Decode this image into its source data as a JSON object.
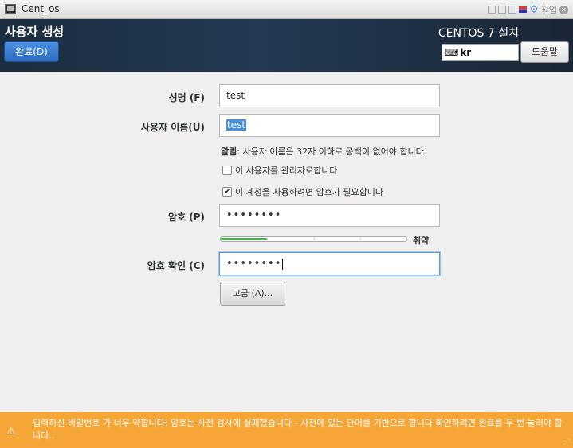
{
  "window": {
    "title": "Cent_os",
    "workspace_label": "작업"
  },
  "header": {
    "page_title": "사용자 생성",
    "done_label": "완료(D)",
    "product_title": "CENTOS 7 설치",
    "keyboard_layout": "kr",
    "help_label": "도움말"
  },
  "form": {
    "fullname": {
      "label": "성명 (F)",
      "value": "test"
    },
    "username": {
      "label": "사용자 이름(U)",
      "value": "test"
    },
    "hint": {
      "prefix": "알림",
      "text": ": 사용자 이름은 32자 이하로 공백이 없어야 합니다."
    },
    "admin_check": {
      "label": "이 사용자를 관리자로합니다",
      "checked": false
    },
    "password_required": {
      "label": "이 계정을 사용하려면 암호가 필요합니다",
      "checked": true
    },
    "password": {
      "label": "암호 (P)",
      "masked": "••••••••"
    },
    "strength": {
      "label": "취약",
      "fraction": 0.25
    },
    "confirm": {
      "label": "암호 확인 (C)",
      "masked": "••••••••"
    },
    "advanced_label": "고급 (A)..."
  },
  "warning": {
    "text": "입력하신 비밀번호 가 너무 약합니다: 암호는 사전 검사에 실패했습니다 - 사전에 있는 단어를 기반으로 합니다  확인하려면 완료를 두 번 눌러야 합니다.."
  },
  "colors": {
    "accent": "#4a90e2",
    "warning_bar": "#f6a637",
    "strength_weak": "#4caf50",
    "header_bg": "#1c2d3f"
  }
}
